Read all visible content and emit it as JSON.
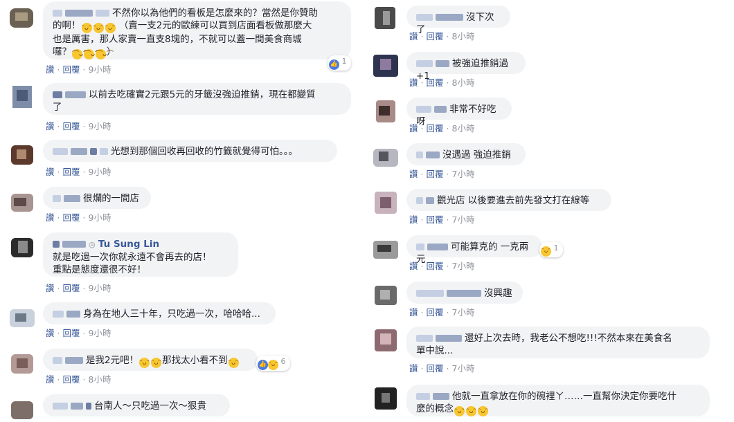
{
  "actions": {
    "reply_prefix": "讚",
    "reply": "回覆",
    "separator": "·"
  },
  "left": [
    {
      "lines": [
        "不然你以為他們的看板是怎麼來的？當然是你贊助",
        "的啊！",
        "（賣一支2元的歐練可以買到店面看板做那麼大",
        "也是厲害，那人家賣一直支8塊的，不就可以蓋一間美食商城",
        "囉？",
        "）"
      ],
      "time": "9小時",
      "reaction_count": "1"
    },
    {
      "lines": [
        "以前去吃確實2元跟5元的牙籤沒強迫推銷，現在都變質",
        "了"
      ],
      "time": "9小時"
    },
    {
      "lines": [
        "光想到那個回收再回收的竹籤就覺得可怕。。。"
      ],
      "time": "9小時"
    },
    {
      "lines": [
        "很爛的一間店"
      ],
      "time": "9小時"
    },
    {
      "author": "Tu Sung Lin",
      "lines": [
        "就是吃過一次你就永遠不會再去的店！",
        "重點是態度還很不好！"
      ],
      "time": "9小時"
    },
    {
      "lines": [
        "身為在地人三十年，只吃過一次，哈哈哈..."
      ],
      "time": "9小時"
    },
    {
      "lines": [
        "是我2元吧！",
        "那找太小看不到"
      ],
      "time": "8小時",
      "reaction_count": "6"
    },
    {
      "lines": [
        "台南人～只吃過一次～狠貴"
      ]
    }
  ],
  "right": [
    {
      "lines": [
        "沒下次了"
      ],
      "time": "8小時"
    },
    {
      "lines": [
        "被強迫推銷過+1"
      ],
      "time": "8小時"
    },
    {
      "lines": [
        "非常不好吃呀"
      ],
      "time": "8小時"
    },
    {
      "lines": [
        "沒遇過 強迫推銷"
      ],
      "time": "7小時"
    },
    {
      "lines": [
        "觀光店 以後要進去前先發文打在線等"
      ],
      "time": "7小時"
    },
    {
      "lines": [
        "可能算克的 一克兩元"
      ],
      "time": "7小時",
      "reaction_count": "1"
    },
    {
      "lines": [
        "沒興趣"
      ],
      "time": "7小時"
    },
    {
      "lines": [
        "還好上次去時，我老公不想吃!!!不然本來在美食名",
        "單中說..."
      ],
      "time": "7小時"
    },
    {
      "lines": [
        "他就一直拿放在你的碗裡ㄚ……一直幫你決定你要吃什",
        "麼的概念"
      ]
    }
  ]
}
